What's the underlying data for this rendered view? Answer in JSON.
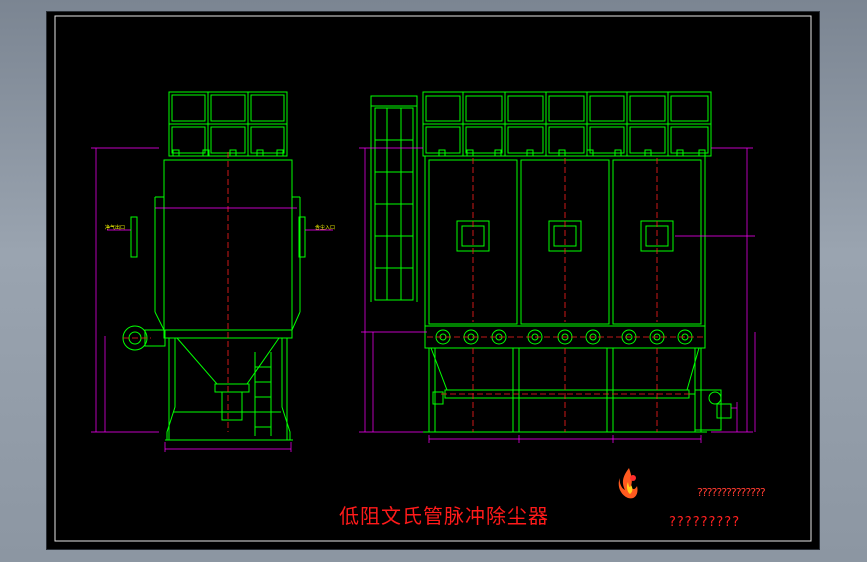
{
  "drawing": {
    "title": "低阻文氏管脉冲除尘器",
    "stamp": {
      "line1": "??????????????",
      "line2": "?????????"
    },
    "side_view": {
      "outlet_label": "净气出口",
      "inlet_label": "含尘入口"
    },
    "colors": {
      "frame": "#00ff00",
      "centerline": "#ff2020",
      "dimension": "#ff00ff",
      "dim_text": "#ffff33",
      "title": "#ff1a1a",
      "background": "#000000"
    },
    "icon": "flame-logo-icon"
  }
}
